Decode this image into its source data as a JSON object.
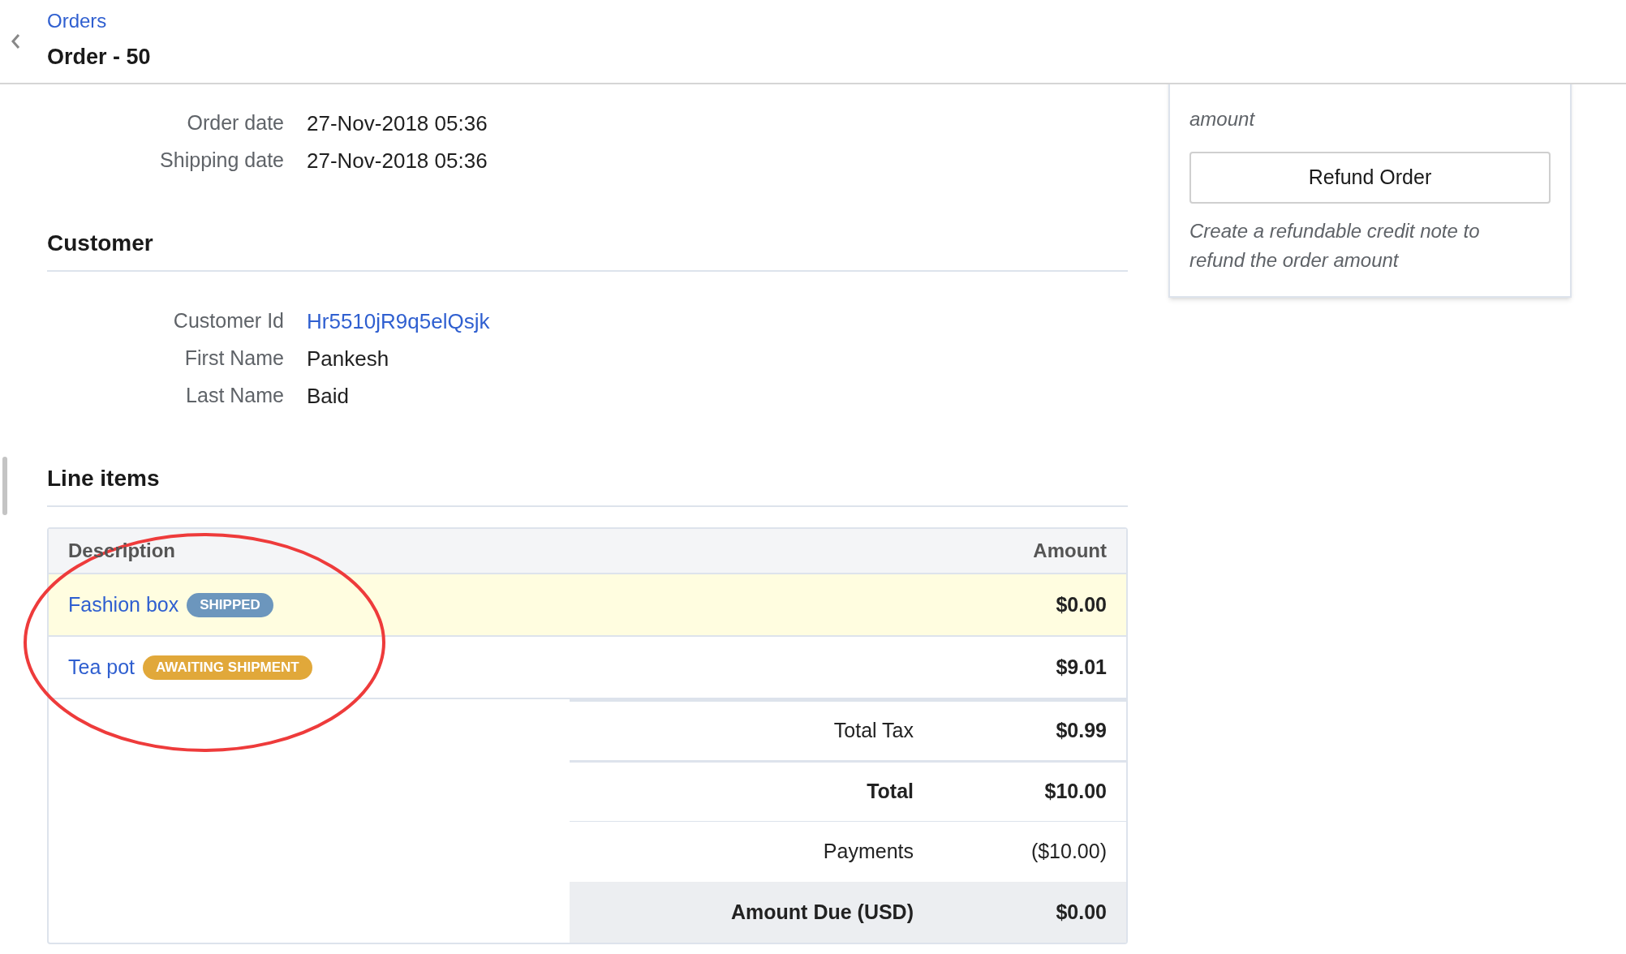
{
  "header": {
    "breadcrumb": "Orders",
    "title": "Order - 50"
  },
  "order_fields": [
    {
      "label": "Order date",
      "value": "27-Nov-2018 05:36"
    },
    {
      "label": "Shipping date",
      "value": "27-Nov-2018 05:36"
    }
  ],
  "customer": {
    "heading": "Customer",
    "fields": [
      {
        "label": "Customer Id",
        "value": "Hr5510jR9q5elQsjk",
        "kind": "link"
      },
      {
        "label": "First Name",
        "value": "Pankesh",
        "kind": "text"
      },
      {
        "label": "Last Name",
        "value": "Baid",
        "kind": "text"
      }
    ]
  },
  "line_items": {
    "heading": "Line items",
    "columns": [
      "Description",
      "Amount"
    ],
    "rows": [
      {
        "description": "Fashion box",
        "status": "SHIPPED",
        "color": "#6c96bd",
        "amount": "$0.00",
        "selected": true
      },
      {
        "description": "Tea pot",
        "status": "AWAITING SHIPMENT",
        "color": "#e1a83a",
        "amount": "$9.01",
        "selected": false
      }
    ],
    "summary": [
      {
        "label": "Total Tax",
        "value": "$0.99",
        "kind": "normal"
      },
      {
        "label": "Total",
        "value": "$10.00",
        "kind": "bold"
      },
      {
        "label": "Payments",
        "value": "($10.00)",
        "kind": "plain"
      },
      {
        "label": "Amount Due (USD)",
        "value": "$0.00",
        "kind": "due"
      }
    ]
  },
  "actions": {
    "cancel_note": "amount",
    "refund_button": "Refund Order",
    "refund_note": "Create a refundable credit note to refund the order amount"
  }
}
